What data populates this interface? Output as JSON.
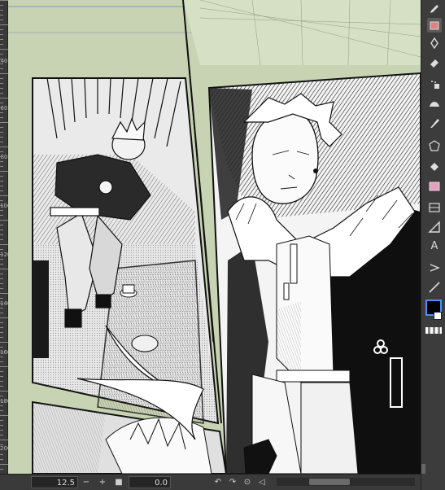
{
  "ruler": {
    "labels": [
      "40",
      "60",
      "80",
      "100",
      "120",
      "140",
      "160",
      "180",
      "200"
    ]
  },
  "statusbar": {
    "zoom_value": "12.5",
    "minus_label": "−",
    "plus_label": "+",
    "angle_value": "0.0"
  },
  "tools": [
    {
      "name": "pen-tool-icon",
      "glyph": "✎"
    },
    {
      "name": "eraser-tool-icon",
      "glyph": "◆"
    },
    {
      "name": "brush-tool-icon",
      "glyph": "✒"
    },
    {
      "name": "blend-tool-icon",
      "glyph": "☁"
    },
    {
      "name": "fill-tool-icon",
      "glyph": "⬣"
    },
    {
      "name": "gradient-tool-icon",
      "glyph": "▥"
    },
    {
      "name": "text-tool-icon",
      "glyph": "A"
    },
    {
      "name": "balloon-tool-icon",
      "glyph": "⌂"
    }
  ],
  "colors": {
    "canvas_bg": "#c7d3b2",
    "main_color": "#000000",
    "sub_color": "#ffffff",
    "accent": "#e4a0c0"
  }
}
